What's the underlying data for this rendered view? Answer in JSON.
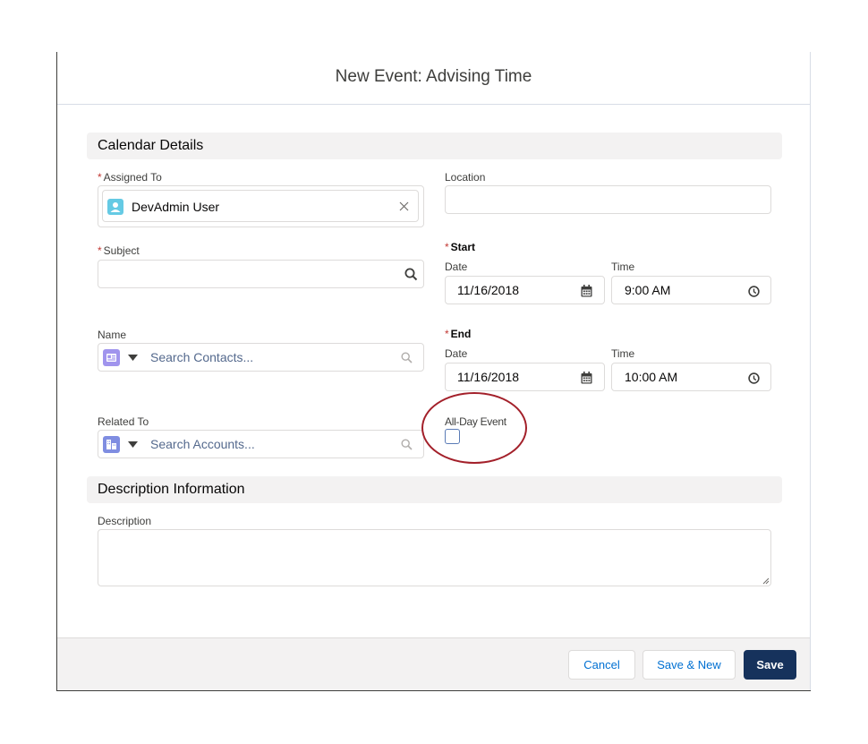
{
  "modal": {
    "title": "New Event: Advising Time"
  },
  "sections": {
    "calendar_details": "Calendar Details",
    "description_information": "Description Information"
  },
  "fields": {
    "assigned_to": {
      "label": "Assigned To",
      "required_mark": "*",
      "value": "DevAdmin User"
    },
    "location": {
      "label": "Location",
      "value": ""
    },
    "subject": {
      "label": "Subject",
      "required_mark": "*",
      "value": ""
    },
    "start": {
      "label": "Start",
      "required_mark": "*",
      "date_label": "Date",
      "date": "11/16/2018",
      "time_label": "Time",
      "time": "9:00 AM"
    },
    "end": {
      "label": "End",
      "required_mark": "*",
      "date_label": "Date",
      "date": "11/16/2018",
      "time_label": "Time",
      "time": "10:00 AM"
    },
    "name": {
      "label": "Name",
      "placeholder": "Search Contacts..."
    },
    "related_to": {
      "label": "Related To",
      "placeholder": "Search Accounts..."
    },
    "all_day_event": {
      "label": "All-Day Event",
      "checked": false
    },
    "description": {
      "label": "Description",
      "value": ""
    }
  },
  "footer": {
    "cancel": "Cancel",
    "save_new": "Save & New",
    "save": "Save"
  },
  "colors": {
    "brand_button": "#16325c",
    "link": "#0070d2",
    "required": "#c23934",
    "annotation_ring": "#a3202a",
    "contact_icon": "#a094ed",
    "account_icon": "#7f8de1",
    "user_icon": "#65cae4"
  },
  "icons": {
    "user": "user-avatar-icon",
    "search": "search-icon",
    "calendar": "calendar-icon",
    "clock": "clock-icon",
    "contact": "contact-icon",
    "account": "account-icon",
    "dropdown": "down-triangle-icon",
    "clear": "close-icon"
  }
}
